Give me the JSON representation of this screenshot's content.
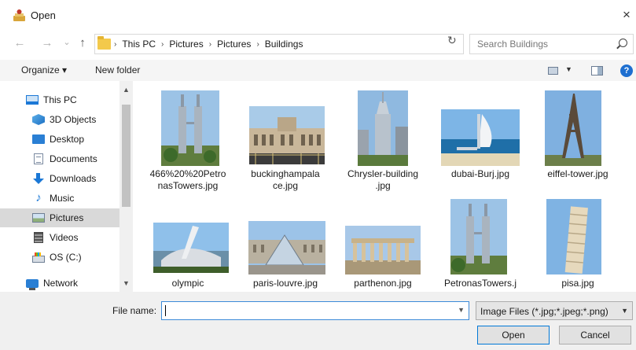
{
  "window": {
    "title": "Open",
    "close_glyph": "×"
  },
  "nav": {
    "back_glyph": "←",
    "forward_glyph": "→",
    "recent_glyph": "⌄",
    "up_glyph": "↑",
    "breadcrumbs": [
      "This PC",
      "Pictures",
      "Pictures",
      "Buildings"
    ],
    "separator": "›",
    "refresh_glyph": "↻",
    "search_placeholder": "Search Buildings"
  },
  "toolbar": {
    "organize_label": "Organize ▾",
    "new_folder_label": "New folder",
    "view_dropdown_glyph": "▼",
    "help_glyph": "?"
  },
  "sidebar": {
    "items": [
      {
        "label": "This PC",
        "icon": "computer-icon"
      },
      {
        "label": "3D Objects",
        "icon": "cube-icon"
      },
      {
        "label": "Desktop",
        "icon": "desktop-icon"
      },
      {
        "label": "Documents",
        "icon": "document-icon"
      },
      {
        "label": "Downloads",
        "icon": "download-icon"
      },
      {
        "label": "Music",
        "icon": "music-icon"
      },
      {
        "label": "Pictures",
        "icon": "pictures-icon",
        "selected": true
      },
      {
        "label": "Videos",
        "icon": "video-icon"
      },
      {
        "label": "OS (C:)",
        "icon": "drive-icon"
      },
      {
        "label": "Network",
        "icon": "network-icon"
      }
    ]
  },
  "files": [
    {
      "name": "466%20%20PetronasTowers.jpg",
      "caption_lines": [
        "466%20%20Petro",
        "nasTowers.jpg"
      ],
      "image": "petronas-towers-photo"
    },
    {
      "name": "buckinghampalace.jpg",
      "caption_lines": [
        "buckinghampala",
        "ce.jpg"
      ],
      "image": "palace-photo"
    },
    {
      "name": "Chrysler-building.jpg",
      "caption_lines": [
        "Chrysler-building",
        ".jpg"
      ],
      "image": "skyscraper-photo"
    },
    {
      "name": "dubai-Burj.jpg",
      "caption_lines": [
        "dubai-Burj.jpg"
      ],
      "image": "burj-al-arab-photo"
    },
    {
      "name": "eiffel-tower.jpg",
      "caption_lines": [
        "eiffel-tower.jpg"
      ],
      "image": "eiffel-tower-photo"
    },
    {
      "name": "olympic",
      "caption_lines": [
        "olympic"
      ],
      "image": "stadium-photo"
    },
    {
      "name": "paris-louvre.jpg",
      "caption_lines": [
        "paris-louvre.jpg"
      ],
      "image": "louvre-photo"
    },
    {
      "name": "parthenon.jpg",
      "caption_lines": [
        "parthenon.jpg"
      ],
      "image": "parthenon-photo"
    },
    {
      "name": "PetronasTowers.j",
      "caption_lines": [
        "PetronasTowers.j"
      ],
      "image": "petronas-towers-photo"
    },
    {
      "name": "pisa.jpg",
      "caption_lines": [
        "pisa.jpg"
      ],
      "image": "leaning-tower-photo"
    }
  ],
  "bottom": {
    "file_name_label": "File name:",
    "file_name_value": "",
    "filter_value": "Image Files (*.jpg;*.jpeg;*.png)",
    "open_label": "Open",
    "cancel_label": "Cancel"
  }
}
